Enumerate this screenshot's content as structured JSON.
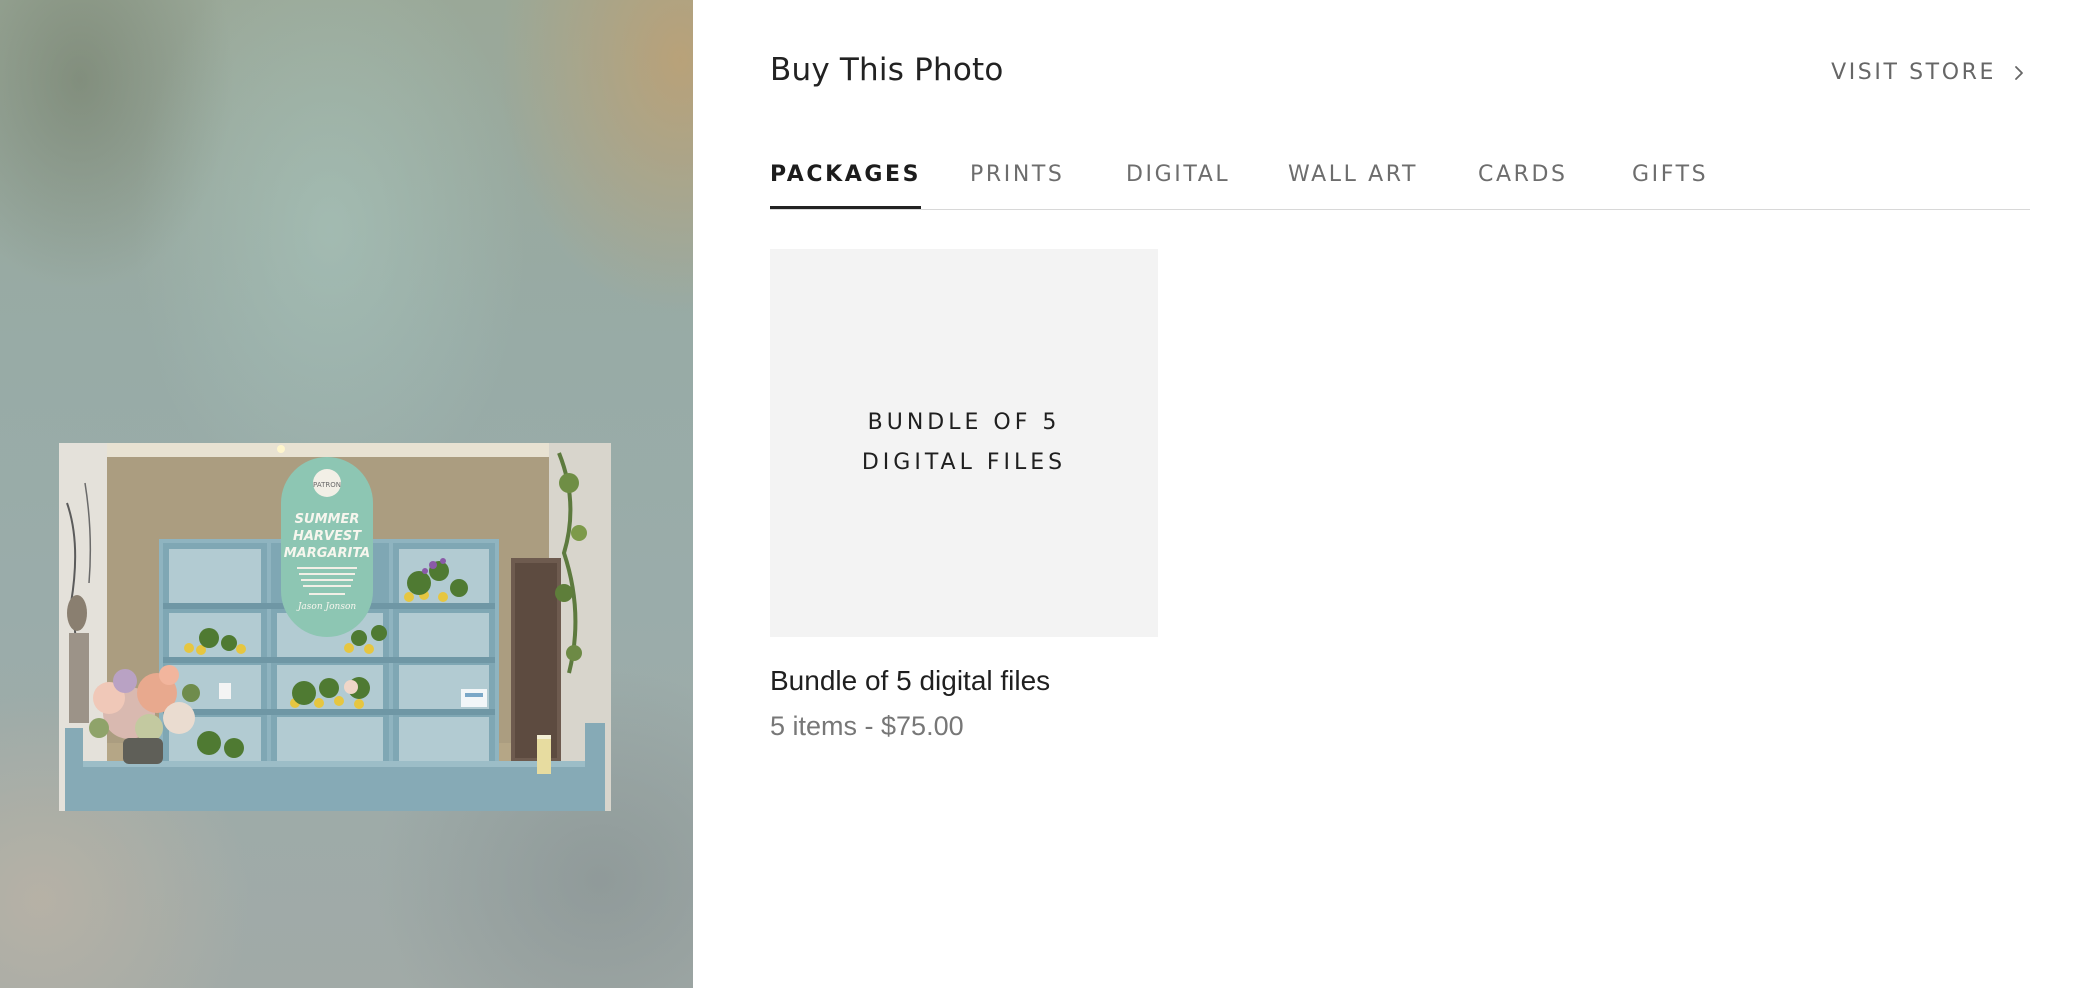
{
  "header": {
    "title": "Buy This Photo",
    "visit_store_label": "VISIT STORE"
  },
  "tabs": [
    {
      "label": "PACKAGES",
      "active": true
    },
    {
      "label": "PRINTS",
      "active": false
    },
    {
      "label": "DIGITAL",
      "active": false
    },
    {
      "label": "WALL ART",
      "active": false
    },
    {
      "label": "CARDS",
      "active": false
    },
    {
      "label": "GIFTS",
      "active": false
    }
  ],
  "products": [
    {
      "thumb_lines": [
        "BUNDLE OF 5",
        "DIGITAL FILES"
      ],
      "name": "Bundle of 5 digital files",
      "meta": "5 items - $75.00"
    }
  ],
  "photo": {
    "sign_brand": "PATRON",
    "sign_lines": [
      "SUMMER",
      "HARVEST",
      "MARGARITA"
    ],
    "sign_signature": "Jason Jonson"
  },
  "icons": {
    "visit_store": "chevron-right-icon"
  }
}
